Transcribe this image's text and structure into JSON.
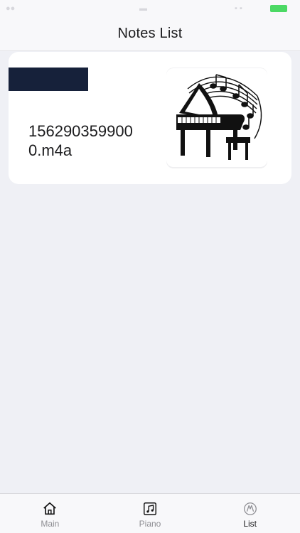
{
  "nav": {
    "title": "Notes List"
  },
  "notes": [
    {
      "filename": "1562903599000.m4a",
      "thumbnail_icon": "piano-music-illustration"
    }
  ],
  "tabbar": {
    "tabs": [
      {
        "label": "Main",
        "icon": "home-icon",
        "active": false
      },
      {
        "label": "Piano",
        "icon": "music-note-icon",
        "active": false
      },
      {
        "label": "List",
        "icon": "list-icon",
        "active": true
      }
    ]
  },
  "colors": {
    "background": "#eff0f5",
    "label_bar": "#16213a",
    "battery": "#4cd964"
  }
}
